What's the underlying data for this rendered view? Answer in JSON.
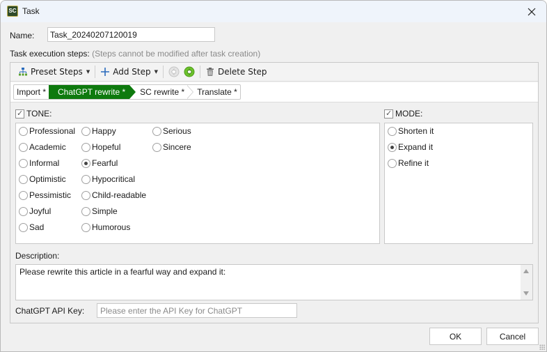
{
  "window": {
    "title": "Task",
    "app_icon_text": "SC"
  },
  "form": {
    "name_label": "Name:",
    "name_value": "Task_20240207120019",
    "steps_label": "Task execution steps:",
    "steps_hint": "(Steps cannot be modified after task creation)"
  },
  "toolbar": {
    "preset_steps": "Preset Steps",
    "add_step": "Add Step",
    "delete_step": "Delete Step"
  },
  "breadcrumbs": [
    {
      "label": "Import *",
      "active": false
    },
    {
      "label": "ChatGPT rewrite *",
      "active": true
    },
    {
      "label": "SC rewrite *",
      "active": false
    },
    {
      "label": "Translate *",
      "active": false
    }
  ],
  "tone": {
    "label": "TONE:",
    "checked": true,
    "selected": "Fearful",
    "columns": [
      [
        "Professional",
        "Academic",
        "Informal",
        "Optimistic",
        "Pessimistic",
        "Joyful",
        "Sad"
      ],
      [
        "Happy",
        "Hopeful",
        "Fearful",
        "Hypocritical",
        "Child-readable",
        "Simple",
        "Humorous"
      ],
      [
        "Serious",
        "Sincere"
      ]
    ]
  },
  "mode": {
    "label": "MODE:",
    "checked": true,
    "selected": "Expand it",
    "options": [
      "Shorten it",
      "Expand it",
      "Refine it"
    ]
  },
  "description": {
    "label": "Description:",
    "value": "Please rewrite this article in a fearful way and expand it:"
  },
  "api_key": {
    "label": "ChatGPT API Key:",
    "value": "",
    "placeholder": "Please enter the API Key for ChatGPT"
  },
  "buttons": {
    "ok": "OK",
    "cancel": "Cancel"
  },
  "colors": {
    "active_step": "#0e7a0e",
    "next_arrow": "#6cc22c"
  }
}
